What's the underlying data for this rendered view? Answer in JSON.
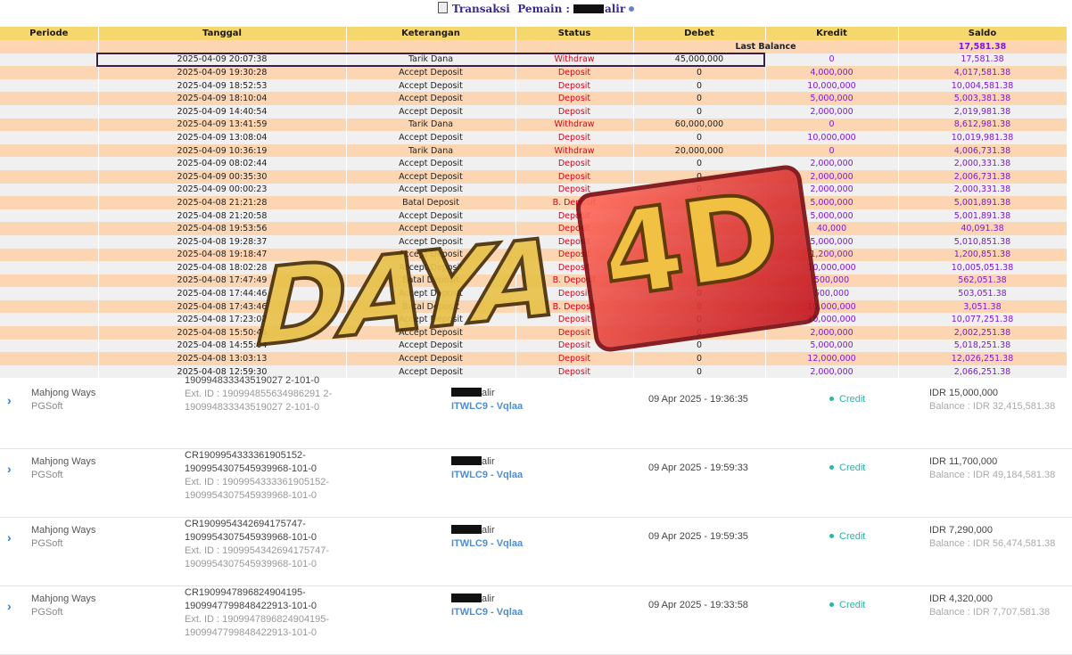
{
  "header": {
    "title_part1": "Transaksi",
    "title_part2": "Pemain :",
    "title_part3": "alir"
  },
  "table": {
    "columns": [
      "Periode",
      "Tanggal",
      "Keterangan",
      "Status",
      "Debet",
      "Kredit",
      "Saldo"
    ],
    "last_balance_label": "Last Balance",
    "last_balance_value": "17,581.38",
    "rows": [
      {
        "tanggal": "2025-04-09 20:07:38",
        "ket": "Tarik Dana",
        "status": "Withdraw",
        "debet": "45,000,000",
        "kredit": "0",
        "saldo": "17,581.38"
      },
      {
        "tanggal": "2025-04-09 19:30:28",
        "ket": "Accept Deposit",
        "status": "Deposit",
        "debet": "0",
        "kredit": "4,000,000",
        "saldo": "4,017,581.38"
      },
      {
        "tanggal": "2025-04-09 18:52:53",
        "ket": "Accept Deposit",
        "status": "Deposit",
        "debet": "0",
        "kredit": "10,000,000",
        "saldo": "10,004,581.38"
      },
      {
        "tanggal": "2025-04-09 18:10:04",
        "ket": "Accept Deposit",
        "status": "Deposit",
        "debet": "0",
        "kredit": "5,000,000",
        "saldo": "5,003,381.38"
      },
      {
        "tanggal": "2025-04-09 14:40:54",
        "ket": "Accept Deposit",
        "status": "Deposit",
        "debet": "0",
        "kredit": "2,000,000",
        "saldo": "2,019,981.38"
      },
      {
        "tanggal": "2025-04-09 13:41:59",
        "ket": "Tarik Dana",
        "status": "Withdraw",
        "debet": "60,000,000",
        "kredit": "0",
        "saldo": "8,612,981.38"
      },
      {
        "tanggal": "2025-04-09 13:08:04",
        "ket": "Accept Deposit",
        "status": "Deposit",
        "debet": "0",
        "kredit": "10,000,000",
        "saldo": "10,019,981.38"
      },
      {
        "tanggal": "2025-04-09 10:36:19",
        "ket": "Tarik Dana",
        "status": "Withdraw",
        "debet": "20,000,000",
        "kredit": "0",
        "saldo": "4,006,731.38"
      },
      {
        "tanggal": "2025-04-09 08:02:44",
        "ket": "Accept Deposit",
        "status": "Deposit",
        "debet": "0",
        "kredit": "2,000,000",
        "saldo": "2,000,331.38"
      },
      {
        "tanggal": "2025-04-09 00:35:30",
        "ket": "Accept Deposit",
        "status": "Deposit",
        "debet": "0",
        "kredit": "2,000,000",
        "saldo": "2,006,731.38"
      },
      {
        "tanggal": "2025-04-09 00:00:23",
        "ket": "Accept Deposit",
        "status": "Deposit",
        "debet": "0",
        "kredit": "2,000,000",
        "saldo": "2,000,331.38"
      },
      {
        "tanggal": "2025-04-08 21:21:28",
        "ket": "Batal Deposit",
        "status": "B. Deposit",
        "debet": "0",
        "kredit": "5,000,000",
        "saldo": "5,001,891.38"
      },
      {
        "tanggal": "2025-04-08 21:20:58",
        "ket": "Accept Deposit",
        "status": "Deposit",
        "debet": "0",
        "kredit": "5,000,000",
        "saldo": "5,001,891.38"
      },
      {
        "tanggal": "2025-04-08 19:53:56",
        "ket": "Accept Deposit",
        "status": "Deposit",
        "debet": "0",
        "kredit": "40,000",
        "saldo": "40,091.38"
      },
      {
        "tanggal": "2025-04-08 19:28:37",
        "ket": "Accept Deposit",
        "status": "Deposit",
        "debet": "0",
        "kredit": "5,000,000",
        "saldo": "5,010,851.38"
      },
      {
        "tanggal": "2025-04-08 19:18:47",
        "ket": "Accept Deposit",
        "status": "Deposit",
        "debet": "0",
        "kredit": "1,200,000",
        "saldo": "1,200,851.38"
      },
      {
        "tanggal": "2025-04-08 18:02:28",
        "ket": "Accept Deposit",
        "status": "Deposit",
        "debet": "0",
        "kredit": "10,000,000",
        "saldo": "10,005,051.38"
      },
      {
        "tanggal": "2025-04-08 17:47:49",
        "ket": "Batal Deposit",
        "status": "B. Deposit",
        "debet": "0",
        "kredit": "500,000",
        "saldo": "562,051.38"
      },
      {
        "tanggal": "2025-04-08 17:44:46",
        "ket": "Accept Deposit",
        "status": "Deposit",
        "debet": "0",
        "kredit": "500,000",
        "saldo": "503,051.38"
      },
      {
        "tanggal": "2025-04-08 17:43:46",
        "ket": "Batal Deposit",
        "status": "B. Deposit",
        "debet": "0",
        "kredit": "10,000,000",
        "saldo": "3,051.38"
      },
      {
        "tanggal": "2025-04-08 17:23:02",
        "ket": "Accept Deposit",
        "status": "Deposit",
        "debet": "0",
        "kredit": "10,000,000",
        "saldo": "10,077,251.38"
      },
      {
        "tanggal": "2025-04-08 15:50:46",
        "ket": "Accept Deposit",
        "status": "Deposit",
        "debet": "0",
        "kredit": "2,000,000",
        "saldo": "2,002,251.38"
      },
      {
        "tanggal": "2025-04-08 14:55:04",
        "ket": "Accept Deposit",
        "status": "Deposit",
        "debet": "0",
        "kredit": "5,000,000",
        "saldo": "5,018,251.38"
      },
      {
        "tanggal": "2025-04-08 13:03:13",
        "ket": "Accept Deposit",
        "status": "Deposit",
        "debet": "0",
        "kredit": "12,000,000",
        "saldo": "12,026,251.38"
      },
      {
        "tanggal": "2025-04-08 12:59:30",
        "ket": "Accept Deposit",
        "status": "Deposit",
        "debet": "0",
        "kredit": "2,000,000",
        "saldo": "2,066,251.38"
      }
    ]
  },
  "bet_list": [
    {
      "game": "Mahjong Ways",
      "provider": "PGSoft",
      "id_line1": "",
      "id_line2": "190994833343519027 2-101-0",
      "ext1": "Ext. ID : 190994855634986291 2-",
      "ext2": "190994833343519027 2-101-0",
      "user_suffix": "alir",
      "agent": "ITWLC9 - Vqlaa",
      "date": "09 Apr 2025 - 19:36:35",
      "type": "Credit",
      "amount": "IDR 15,000,000",
      "balance": "Balance : IDR 32,415,581.38"
    },
    {
      "game": "Mahjong Ways",
      "provider": "PGSoft",
      "id_line1": "CR1909954333361905152-",
      "id_line2": "1909954307545939968-101-0",
      "ext1": "Ext. ID : 1909954333361905152-",
      "ext2": "1909954307545939968-101-0",
      "user_suffix": "alir",
      "agent": "ITWLC9 - Vqlaa",
      "date": "09 Apr 2025 - 19:59:33",
      "type": "Credit",
      "amount": "IDR 11,700,000",
      "balance": "Balance : IDR 49,184,581.38"
    },
    {
      "game": "Mahjong Ways",
      "provider": "PGSoft",
      "id_line1": "CR1909954342694175747-",
      "id_line2": "1909954307545939968-101-0",
      "ext1": "Ext. ID : 1909954342694175747-",
      "ext2": "1909954307545939968-101-0",
      "user_suffix": "alir",
      "agent": "ITWLC9 - Vqlaa",
      "date": "09 Apr 2025 - 19:59:35",
      "type": "Credit",
      "amount": "IDR 7,290,000",
      "balance": "Balance : IDR 56,474,581.38"
    },
    {
      "game": "Mahjong Ways",
      "provider": "PGSoft",
      "id_line1": "CR1909947896824904195-",
      "id_line2": "1909947799848422913-101-0",
      "ext1": "Ext. ID : 1909947896824904195-",
      "ext2": "1909947799848422913-101-0",
      "user_suffix": "alir",
      "agent": "ITWLC9 - Vqlaa",
      "date": "09 Apr 2025 - 19:33:58",
      "type": "Credit",
      "amount": "IDR 4,320,000",
      "balance": "Balance : IDR 7,707,581.38"
    }
  ],
  "watermark": {
    "word1": "DAYA",
    "word2": "4D"
  },
  "colors": {
    "header_bg": "#f5d76e",
    "row_even": "#f0f0f0",
    "row_odd": "#fcd6b2",
    "status_red": "#e0001a",
    "amount_purple": "#7d18d6",
    "credit_teal": "#2ab5a5",
    "agent_blue": "#4a8ed6"
  }
}
